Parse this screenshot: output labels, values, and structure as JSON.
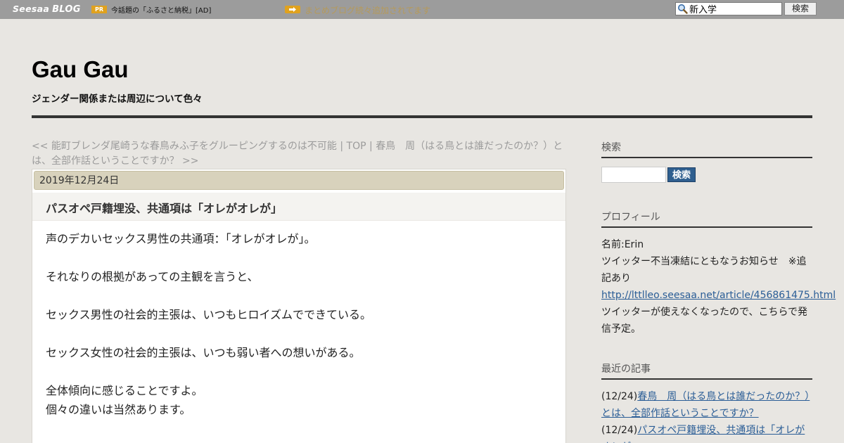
{
  "topbar": {
    "logo_part1": "Seesaa",
    "logo_part2": "BLOG",
    "pr_badge": "PR",
    "pr_text": "今話題の「ふるさと納税」[AD]",
    "notice": "まとめブログ続々追加されてます",
    "search_value": "新入学",
    "search_button": "検索"
  },
  "header": {
    "title": "Gau Gau",
    "description": "ジェンダー関係または周辺について色々"
  },
  "pager": {
    "prev": "<< 能町ブレンダ尾崎うな春鳥みふ子をグルーピングするのは不可能",
    "sep1": " | ",
    "top": "TOP",
    "sep2": " | ",
    "next": "春鳥　周（はる鳥とは誰だったのか？）とは、全部作話ということですか？ >>"
  },
  "article": {
    "date": "2019年12月24日",
    "title": "パスオペ戸籍埋没、共通項は「オレがオレが」",
    "body": [
      "声のデカいセックス男性の共通項：「オレがオレが」。",
      "",
      "それなりの根拠があっての主観を言うと、",
      "",
      "セックス男性の社会的主張は、いつもヒロイズムでできている。",
      "",
      "セックス女性の社会的主張は、いつも弱い者への想いがある。",
      "",
      "全体傾向に感じることですよ。",
      "個々の違いは当然あります。"
    ]
  },
  "sidebar": {
    "search": {
      "heading": "検索",
      "input_value": "",
      "button": "検索"
    },
    "profile": {
      "heading": "プロフィール",
      "name": "名前:Erin",
      "note": "ツイッター不当凍結にともなうお知らせ　※追記あり",
      "link": "http://lttlleo.seesaa.net/article/456861475.html",
      "note2": "ツイッターが使えなくなったので、こちらで発信予定。"
    },
    "recent": {
      "heading": "最近の記事",
      "items": [
        {
          "date": "(12/24)",
          "title": "春鳥　周（はる鳥とは誰だったのか？）とは、全部作話ということですか？"
        },
        {
          "date": "(12/24)",
          "title": "パスオペ戸籍埋没、共通項は「オレがオレが」"
        }
      ]
    }
  }
}
